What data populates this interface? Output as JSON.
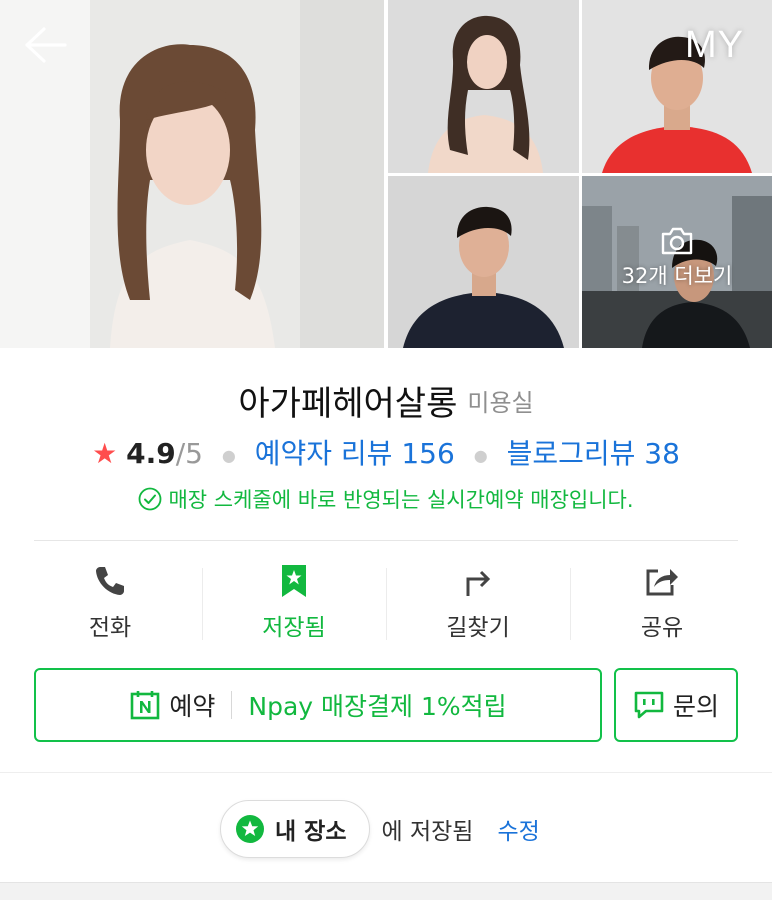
{
  "header": {
    "back_icon": "arrow-left-icon",
    "my_label": "MY",
    "more_photos_label": "32개 더보기",
    "camera_icon": "camera-icon"
  },
  "place": {
    "name": "아가페헤어살롱",
    "category": "미용실",
    "rating": "4.9",
    "rating_max": "/5",
    "visitor_review_label": "예약자 리뷰 156",
    "blog_review_label": "블로그리뷰 38",
    "realtime_notice": "매장 스케줄에 바로 반영되는 실시간예약 매장입니다."
  },
  "actions": [
    {
      "label": "전화",
      "icon": "phone-icon"
    },
    {
      "label": "저장됨",
      "icon": "bookmark-star-icon"
    },
    {
      "label": "길찾기",
      "icon": "directions-icon"
    },
    {
      "label": "공유",
      "icon": "share-icon"
    }
  ],
  "booking": {
    "reserve_label": "예약",
    "npay_label": "Npay 매장결제 1%적립",
    "inquiry_label": "문의"
  },
  "saved": {
    "chip_label": "내 장소",
    "saved_text": "에 저장됨",
    "edit_label": "수정"
  },
  "colors": {
    "accent_green": "#12b83f",
    "link_blue": "#1a73d9",
    "star_red": "#ff4d4d"
  }
}
